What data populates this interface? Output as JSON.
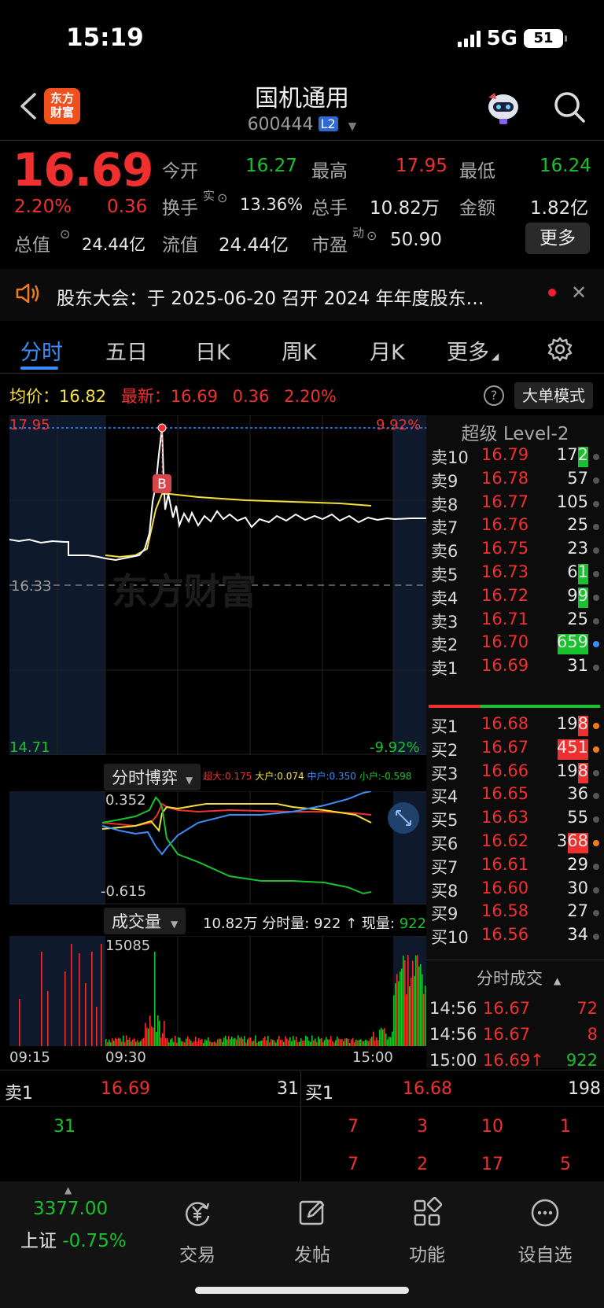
{
  "status_bar": {
    "time": "15:19",
    "network": "5G",
    "battery": "51"
  },
  "header": {
    "stock_name": "国机通用",
    "stock_code": "600444",
    "level_badge": "L2",
    "logo_text_line1": "东方",
    "logo_text_line2": "财富"
  },
  "quote": {
    "price": "16.69",
    "change_pct": "2.20%",
    "change": "0.36",
    "open_label": "今开",
    "open": "16.27",
    "high_label": "最高",
    "high": "17.95",
    "low_label": "最低",
    "low": "16.24",
    "turnover_label": "换手",
    "turnover_sup": "实",
    "turnover": "13.36%",
    "volume_label": "总手",
    "volume": "10.82万",
    "amount_label": "金额",
    "amount": "1.82亿",
    "mktcap_label": "总值",
    "mktcap": "24.44亿",
    "float_label": "流值",
    "float_cap": "24.44亿",
    "pe_label": "市盈",
    "pe_sup": "动",
    "pe": "50.90",
    "more_label": "更多"
  },
  "notice": {
    "text": "股东大会：于 2025-06-20 召开 2024 年年度股东…"
  },
  "tabs": [
    "分时",
    "五日",
    "日K",
    "周K",
    "月K",
    "更多"
  ],
  "avg_row": {
    "avg_label": "均价：",
    "avg": "16.82",
    "latest_label": "最新：",
    "latest": "16.69",
    "chg": "0.36",
    "pct": "2.20%",
    "mode_button": "大单模式"
  },
  "chart": {
    "top_left": "17.95",
    "top_right": "9.92%",
    "mid_label": "16.33",
    "bottom_left": "14.71",
    "bottom_right": "-9.92%",
    "marker": "B",
    "watermark": "东方财富",
    "colors": {
      "price_line": "#ffffff",
      "avg_line": "#f3e13a",
      "ref_line": "#3b8df7"
    }
  },
  "game": {
    "title": "分时博弈",
    "legend": [
      {
        "label": "超大:0.175",
        "color": "#f0302e"
      },
      {
        "label": "大户:0.074",
        "color": "#f3e13a"
      },
      {
        "label": "中户:0.350",
        "color": "#3b8df7"
      },
      {
        "label": "小户:-0.598",
        "color": "#19c12e"
      }
    ],
    "top": "0.352",
    "bottom": "-0.615"
  },
  "volume": {
    "title": "成交量",
    "summary": "10.82万  分时量: 922 ↑ 现量:",
    "current": "922",
    "axis_max": "15085",
    "time_labels": [
      "09:15",
      "09:30",
      "15:00"
    ]
  },
  "orderbook": {
    "title": "超级 Level-2",
    "asks": [
      {
        "label": "卖10",
        "price": "16.79",
        "vol": "172"
      },
      {
        "label": "卖9",
        "price": "16.78",
        "vol": "57"
      },
      {
        "label": "卖8",
        "price": "16.77",
        "vol": "105"
      },
      {
        "label": "卖7",
        "price": "16.76",
        "vol": "25"
      },
      {
        "label": "卖6",
        "price": "16.75",
        "vol": "23"
      },
      {
        "label": "卖5",
        "price": "16.73",
        "vol": "61"
      },
      {
        "label": "卖4",
        "price": "16.72",
        "vol": "99"
      },
      {
        "label": "卖3",
        "price": "16.71",
        "vol": "25"
      },
      {
        "label": "卖2",
        "price": "16.70",
        "vol": "659"
      },
      {
        "label": "卖1",
        "price": "16.69",
        "vol": "31"
      }
    ],
    "bids": [
      {
        "label": "买1",
        "price": "16.68",
        "vol": "198"
      },
      {
        "label": "买2",
        "price": "16.67",
        "vol": "451"
      },
      {
        "label": "买3",
        "price": "16.66",
        "vol": "198"
      },
      {
        "label": "买4",
        "price": "16.65",
        "vol": "36"
      },
      {
        "label": "买5",
        "price": "16.63",
        "vol": "55"
      },
      {
        "label": "买6",
        "price": "16.62",
        "vol": "368"
      },
      {
        "label": "买7",
        "price": "16.61",
        "vol": "29"
      },
      {
        "label": "买8",
        "price": "16.60",
        "vol": "30"
      },
      {
        "label": "买9",
        "price": "16.58",
        "vol": "27"
      },
      {
        "label": "买10",
        "price": "16.56",
        "vol": "34"
      }
    ],
    "ticks_title": "分时成交",
    "ticks": [
      {
        "time": "14:56",
        "price": "16.67",
        "vol": "72"
      },
      {
        "time": "14:56",
        "price": "16.67",
        "vol": "8"
      },
      {
        "time": "15:00",
        "price": "16.69↑",
        "vol": "922"
      }
    ]
  },
  "bottom_quote": {
    "sell1_label": "卖1",
    "sell1_price": "16.69",
    "sell1_vol": "31",
    "buy1_label": "买1",
    "buy1_price": "16.68",
    "buy1_vol": "198",
    "sell_queue": [
      "31"
    ],
    "buy_queue_row1": [
      "7",
      "3",
      "10",
      "1"
    ],
    "buy_queue_row2": [
      "7",
      "2",
      "17",
      "5"
    ]
  },
  "bottom_nav": {
    "index_value": "3377.00",
    "index_name": "上证",
    "index_change": "-0.75%",
    "items": [
      "交易",
      "发帖",
      "功能",
      "设自选"
    ]
  }
}
